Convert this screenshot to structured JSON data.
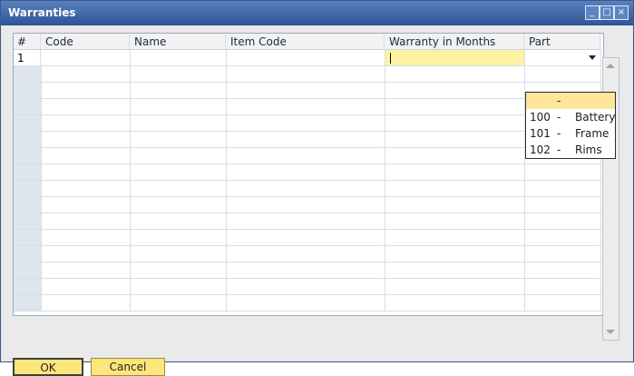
{
  "window": {
    "title": "Warranties"
  },
  "table": {
    "columns": [
      "#",
      "Code",
      "Name",
      "Item Code",
      "Warranty in Months",
      "Part"
    ],
    "rows": [
      {
        "num": "1"
      }
    ]
  },
  "dropdown": {
    "options": [
      {
        "code": "",
        "dash": "-",
        "name": ""
      },
      {
        "code": "100",
        "dash": "-",
        "name": "Battery"
      },
      {
        "code": "101",
        "dash": "-",
        "name": "Frame"
      },
      {
        "code": "102",
        "dash": "-",
        "name": "Rims"
      }
    ]
  },
  "buttons": {
    "ok": "OK",
    "cancel": "Cancel"
  }
}
